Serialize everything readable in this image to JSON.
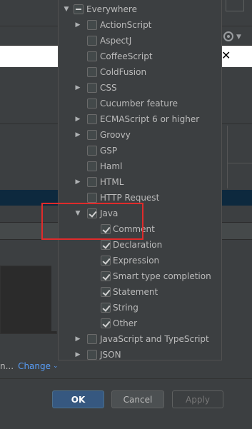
{
  "popup": {
    "items": [
      {
        "label": "Everywhere",
        "state": "partial",
        "arrow": "down",
        "indent": 0
      },
      {
        "label": "ActionScript",
        "state": "unchecked",
        "arrow": "right",
        "indent": 1
      },
      {
        "label": "AspectJ",
        "state": "unchecked",
        "arrow": "none",
        "indent": 1
      },
      {
        "label": "CoffeeScript",
        "state": "unchecked",
        "arrow": "none",
        "indent": 1
      },
      {
        "label": "ColdFusion",
        "state": "unchecked",
        "arrow": "none",
        "indent": 1
      },
      {
        "label": "CSS",
        "state": "unchecked",
        "arrow": "right",
        "indent": 1
      },
      {
        "label": "Cucumber feature",
        "state": "unchecked",
        "arrow": "none",
        "indent": 1
      },
      {
        "label": "ECMAScript 6 or higher",
        "state": "unchecked",
        "arrow": "right",
        "indent": 1
      },
      {
        "label": "Groovy",
        "state": "unchecked",
        "arrow": "right",
        "indent": 1
      },
      {
        "label": "GSP",
        "state": "unchecked",
        "arrow": "none",
        "indent": 1
      },
      {
        "label": "Haml",
        "state": "unchecked",
        "arrow": "none",
        "indent": 1
      },
      {
        "label": "HTML",
        "state": "unchecked",
        "arrow": "right",
        "indent": 1
      },
      {
        "label": "HTTP Request",
        "state": "unchecked",
        "arrow": "none",
        "indent": 1
      },
      {
        "label": "Java",
        "state": "checked",
        "arrow": "down",
        "indent": 1
      },
      {
        "label": "Comment",
        "state": "checked",
        "arrow": "none",
        "indent": 2
      },
      {
        "label": "Declaration",
        "state": "checked",
        "arrow": "none",
        "indent": 2
      },
      {
        "label": "Expression",
        "state": "checked",
        "arrow": "none",
        "indent": 2
      },
      {
        "label": "Smart type completion",
        "state": "checked",
        "arrow": "none",
        "indent": 2
      },
      {
        "label": "Statement",
        "state": "checked",
        "arrow": "none",
        "indent": 2
      },
      {
        "label": "String",
        "state": "checked",
        "arrow": "none",
        "indent": 2
      },
      {
        "label": "Other",
        "state": "checked",
        "arrow": "none",
        "indent": 2
      },
      {
        "label": "JavaScript and TypeScript",
        "state": "unchecked",
        "arrow": "right",
        "indent": 1
      },
      {
        "label": "JSON",
        "state": "unchecked",
        "arrow": "right",
        "indent": 1
      }
    ]
  },
  "context": {
    "ellipsis": "n...",
    "change_label": "Change"
  },
  "buttons": {
    "ok": "OK",
    "cancel": "Cancel",
    "apply": "Apply"
  },
  "colors": {
    "highlight": "#e02b2b",
    "link": "#589df6",
    "ok_button": "#365880"
  }
}
